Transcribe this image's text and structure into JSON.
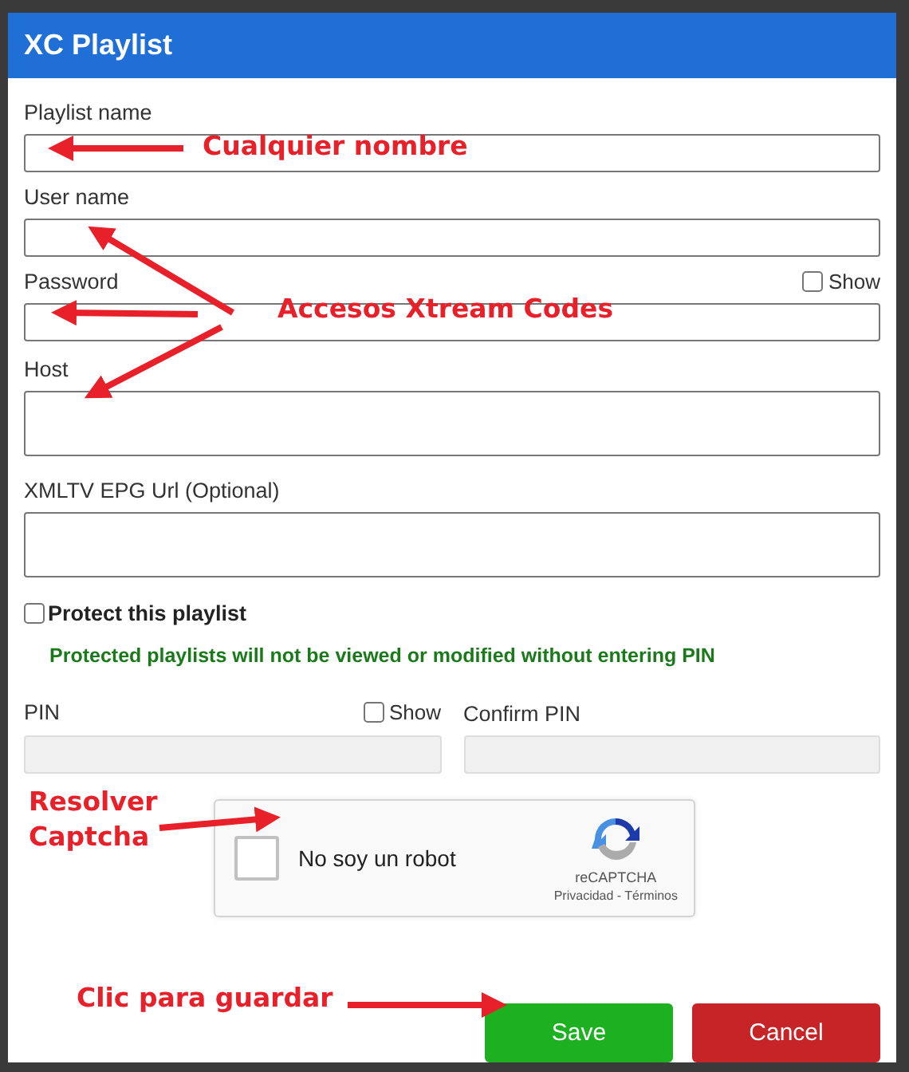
{
  "dialog": {
    "title": "XC Playlist"
  },
  "fields": [
    {
      "label": "Playlist name",
      "kind": "text"
    },
    {
      "label": "User name",
      "kind": "text"
    },
    {
      "label": "Password",
      "kind": "password",
      "show_label": "Show",
      "show_checked": false
    },
    {
      "label": "Host",
      "kind": "tall"
    },
    {
      "label": "XMLTV EPG Url (Optional)",
      "kind": "tall"
    }
  ],
  "protect": {
    "label": "Protect this playlist",
    "checked": false,
    "note": "Protected playlists will not be viewed or modified without entering PIN"
  },
  "pin": {
    "label": "PIN",
    "show_label": "Show",
    "show_checked": false,
    "confirm_label": "Confirm PIN",
    "disabled": true
  },
  "captcha": {
    "label": "No soy un robot",
    "checked": false,
    "brand": "reCAPTCHA",
    "links": "Privacidad - Términos"
  },
  "buttons": [
    {
      "label": "Save",
      "kind": "save"
    },
    {
      "label": "Cancel",
      "kind": "cancel"
    }
  ],
  "annotations": [
    {
      "text": "Cualquier nombre"
    },
    {
      "text": "Accesos Xtream Codes"
    },
    {
      "text": "Resolver Captcha"
    },
    {
      "text": "Clic para guardar"
    }
  ]
}
